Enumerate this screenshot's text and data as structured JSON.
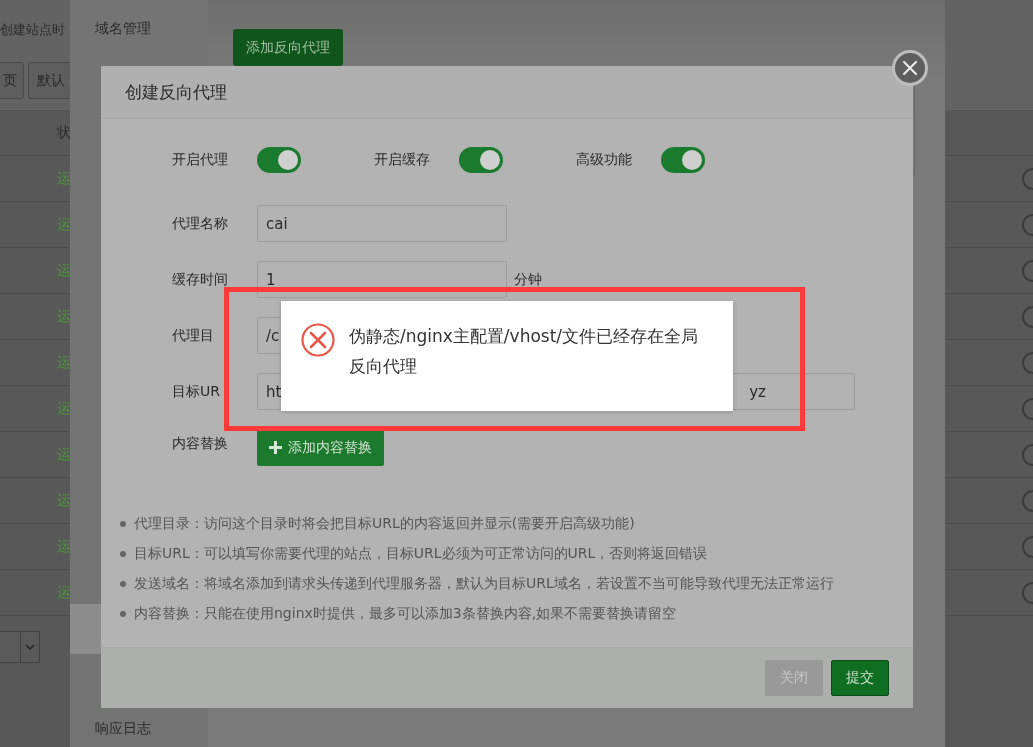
{
  "background_page": {
    "heading": "创建站点时",
    "buttons": [
      "页",
      "默认"
    ],
    "table": {
      "column_1": "状",
      "rows": [
        {
          "column_1": "运"
        },
        {
          "column_1": "运"
        },
        {
          "column_1": "运"
        },
        {
          "column_1": "运"
        },
        {
          "column_1": "运"
        },
        {
          "column_1": "运"
        },
        {
          "column_1": "运"
        },
        {
          "column_1": "运"
        },
        {
          "column_1": "运"
        },
        {
          "column_1": "运"
        }
      ]
    }
  },
  "site_settings": {
    "sidebar": {
      "items": [
        {
          "label": "域名管理",
          "selected": false
        },
        {
          "selected": true
        },
        {
          "label": "响应日志",
          "selected": false
        }
      ]
    },
    "add_button": "添加反向代理"
  },
  "dialog": {
    "title": "创建反向代理",
    "switches": [
      {
        "label": "开启代理",
        "on": true
      },
      {
        "label": "开启缓存",
        "on": true
      },
      {
        "label": "高级功能",
        "on": true
      }
    ],
    "fields": [
      {
        "label": "代理名称",
        "value": "cai"
      },
      {
        "label": "缓存时间",
        "value": "1",
        "unit": "分钟"
      },
      {
        "label": "代理目",
        "value": "/c"
      },
      {
        "label": "目标UR",
        "value": "ht",
        "value_end": "yz"
      }
    ],
    "content_replace": {
      "label": "内容替换",
      "button": "添加内容替换"
    },
    "notes": [
      "代理目录：访问这个目录时将会把目标URL的内容返回并显示(需要开启高级功能)",
      "目标URL：可以填写你需要代理的站点，目标URL必须为可正常访问的URL，否则将返回错误",
      "发送域名：将域名添加到请求头传递到代理服务器，默认为目标URL域名，若设置不当可能导致代理无法正常运行",
      "内容替换：只能在使用nginx时提供，最多可以添加3条替换内容,如果不需要替换请留空"
    ],
    "buttons": [
      {
        "label": "关闭",
        "kind": "close",
        "disabled": true
      },
      {
        "label": "提交",
        "kind": "submit",
        "disabled": false
      }
    ]
  },
  "error_toast": {
    "message": "伪静态/nginx主配置/vhost/文件已经存在全局反向代理"
  }
}
